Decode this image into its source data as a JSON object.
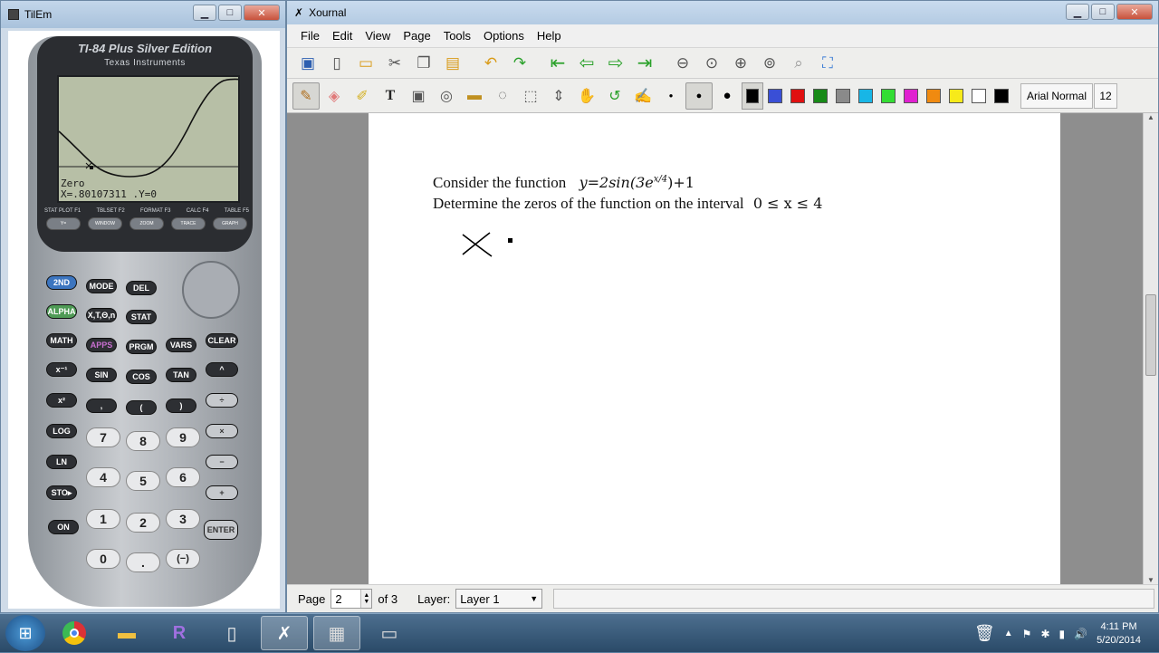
{
  "tilem": {
    "title": "TilEm",
    "brand": "TI-84 Plus Silver Edition",
    "maker": "Texas Instruments",
    "screen_line1": "Zero",
    "screen_line2": "X=.80107311 .Y=0",
    "fn_labels": [
      "STAT PLOT F1",
      "TBLSET F2",
      "FORMAT F3",
      "CALC F4",
      "TABLE F5"
    ],
    "fn_keys": [
      "Y=",
      "WINDOW",
      "ZOOM",
      "TRACE",
      "GRAPH"
    ],
    "keys": {
      "second": "2ND",
      "mode": "MODE",
      "del": "DEL",
      "alpha": "ALPHA",
      "xton": "X,T,Θ,n",
      "stat": "STAT",
      "math": "MATH",
      "apps": "APPS",
      "prgm": "PRGM",
      "vars": "VARS",
      "clear": "CLEAR",
      "inv": "x⁻¹",
      "sin": "SIN",
      "cos": "COS",
      "tan": "TAN",
      "pow": "^",
      "sq": "x²",
      "comma": ",",
      "lparen": "(",
      "rparen": ")",
      "div": "÷",
      "log": "LOG",
      "seven": "7",
      "eight": "8",
      "nine": "9",
      "mul": "×",
      "ln": "LN",
      "four": "4",
      "five": "5",
      "six": "6",
      "minus": "−",
      "sto": "STO▸",
      "one": "1",
      "two": "2",
      "three": "3",
      "plus": "+",
      "on": "ON",
      "zero": "0",
      "dot": ".",
      "neg": "(−)",
      "enter": "ENTER"
    }
  },
  "xournal": {
    "title": "Xournal",
    "menu": [
      "File",
      "Edit",
      "View",
      "Page",
      "Tools",
      "Options",
      "Help"
    ],
    "font_name": "Arial Normal",
    "font_size": "12",
    "colors": [
      "#000000",
      "#3a4fd6",
      "#e01010",
      "#178a17",
      "#8a8a8a",
      "#18b6e6",
      "#33dd33",
      "#e020d0",
      "#f08a10",
      "#f7ea1a",
      "#ffffff",
      "#000000"
    ],
    "doc": {
      "line1_prefix": "Consider the function",
      "line1_math_a": "y=2sin(3e",
      "line1_math_exp": "x/4",
      "line1_math_b": ")+1",
      "line2_prefix": "Determine the zeros of the function on the interval",
      "line2_math": "0 ≤ x ≤ 4"
    },
    "status": {
      "page_label": "Page",
      "page_value": "2",
      "page_of": "of 3",
      "layer_label": "Layer:",
      "layer_value": "Layer 1"
    }
  },
  "taskbar": {
    "time": "4:11 PM",
    "date": "5/20/2014"
  }
}
